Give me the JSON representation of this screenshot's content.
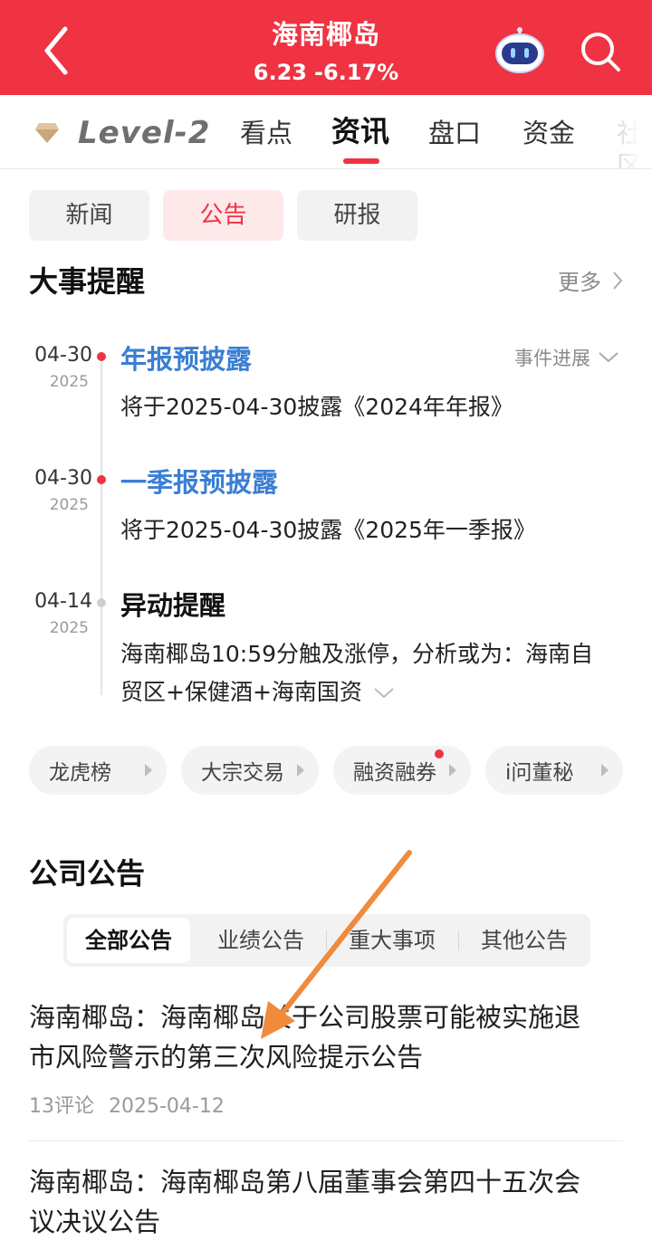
{
  "header": {
    "title": "海南椰岛",
    "price": "6.23",
    "change_pct": "-6.17%",
    "bg_color": "#ef3342",
    "icons": [
      "back-arrow-icon",
      "robot-assistant-icon",
      "search-icon"
    ]
  },
  "tabs": {
    "level2_label": "Level-2",
    "items": [
      "看点",
      "资讯",
      "盘口",
      "资金",
      "社区"
    ],
    "active": "资讯"
  },
  "subtabs": {
    "items": [
      "新闻",
      "公告",
      "研报"
    ],
    "active": "公告"
  },
  "events": {
    "title": "大事提醒",
    "more": "更多",
    "progress_label": "事件进展",
    "items": [
      {
        "date": "04-30",
        "year": "2025",
        "title": "年报预披露",
        "desc": "将于2025-04-30披露《2024年年报》"
      },
      {
        "date": "04-30",
        "year": "2025",
        "title": "一季报预披露",
        "desc": "将于2025-04-30披露《2025年一季报》"
      },
      {
        "date": "04-14",
        "year": "2025",
        "title": "异动提醒",
        "desc_line1": "海南椰岛10:59分触及涨停，分析或为：海南自",
        "desc_line2": "贸区+保健酒+海南国资"
      }
    ]
  },
  "quick_links": [
    "龙虎榜",
    "大宗交易",
    "融资融券",
    "i问董秘"
  ],
  "announcements": {
    "title": "公司公告",
    "filters": [
      "全部公告",
      "业绩公告",
      "重大事项",
      "其他公告"
    ],
    "active_filter": "全部公告",
    "items": [
      {
        "title_line1": "海南椰岛：海南椰岛关于公司股票可能被实施退",
        "title_line2": "市风险警示的第三次风险提示公告",
        "comments": "13评论",
        "date": "2025-04-12"
      },
      {
        "title_line1": "海南椰岛：海南椰岛第八届董事会第四十五次会",
        "title_line2": "议决议公告"
      }
    ]
  },
  "colors": {
    "accent": "#ef3342",
    "event_blue": "#3b7fd4",
    "arrow": "#f08a3c"
  }
}
